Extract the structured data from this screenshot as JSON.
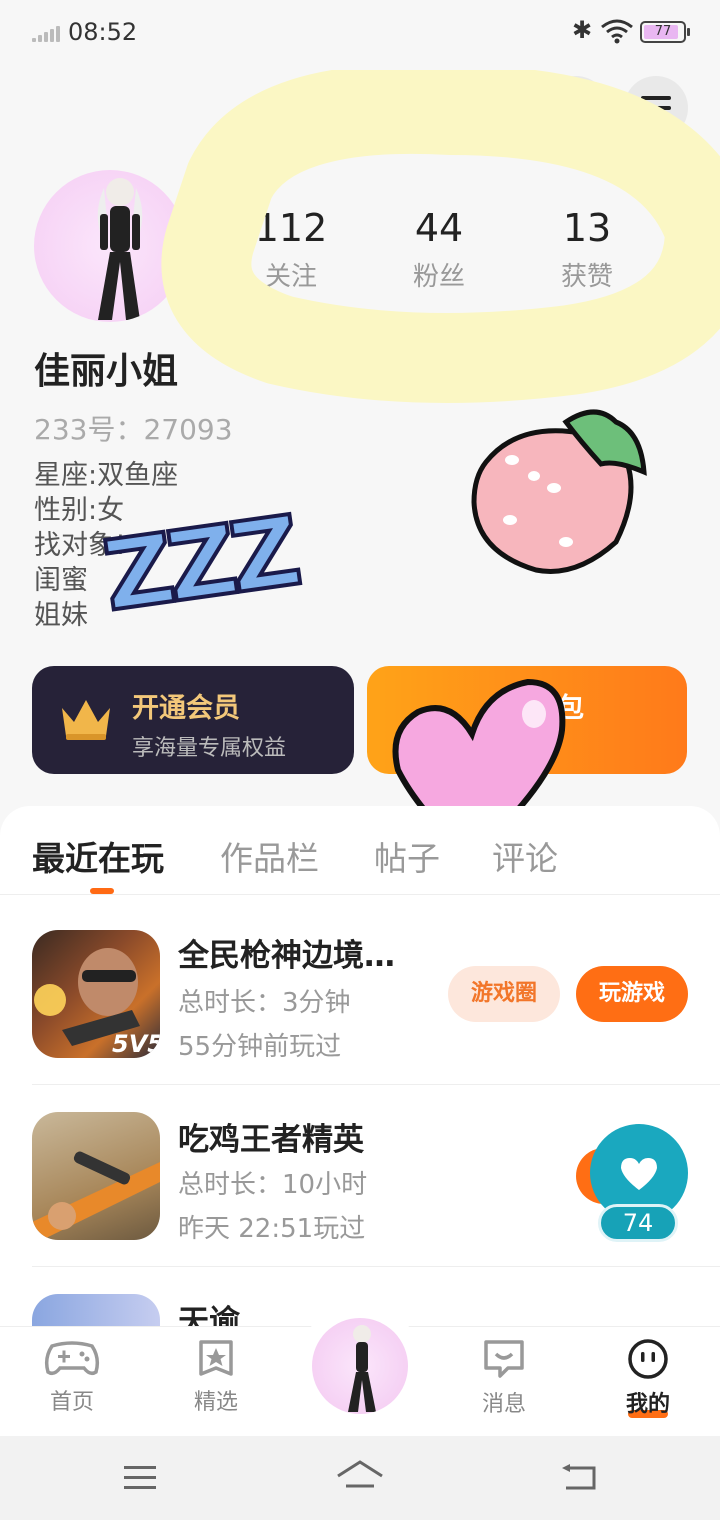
{
  "status_bar": {
    "time": "08:52",
    "battery": "77"
  },
  "stats": [
    {
      "num": "112",
      "label": "关注"
    },
    {
      "num": "44",
      "label": "粉丝"
    },
    {
      "num": "13",
      "label": "获赞"
    }
  ],
  "profile": {
    "name": "佳丽小姐",
    "uid": "233号：27093",
    "bio": [
      "星座:双鱼座",
      "性别:女",
      "找对象!",
      "闺蜜",
      "姐妹"
    ]
  },
  "vip_card": {
    "title": "开通会员",
    "subtitle": "享海量专属权益"
  },
  "gift_card": {
    "title": "包"
  },
  "tabs": [
    "最近在玩",
    "作品栏",
    "帖子",
    "评论"
  ],
  "games": [
    {
      "title": "全民枪神边境…",
      "duration": "总时长：3分钟",
      "last_played": "55分钟前玩过",
      "circle_btn": "游戏圈",
      "play_btn": "玩游戏"
    },
    {
      "title": "吃鸡王者精英",
      "duration": "总时长：10小时",
      "last_played": "昨天 22:51玩过"
    },
    {
      "title": "天谕"
    }
  ],
  "floating_like": {
    "count": "74"
  },
  "bottom_nav": [
    {
      "label": "首页",
      "icon": "gamepad-icon"
    },
    {
      "label": "精选",
      "icon": "star-bookmark-icon"
    },
    {
      "label": "消息",
      "icon": "message-icon"
    },
    {
      "label": "我的",
      "icon": "smile-face-icon"
    }
  ],
  "colors": {
    "accent": "#ff6e14",
    "vip_bg": "#262238",
    "vip_gold": "#f3c87a",
    "teal": "#1aa8bf"
  }
}
